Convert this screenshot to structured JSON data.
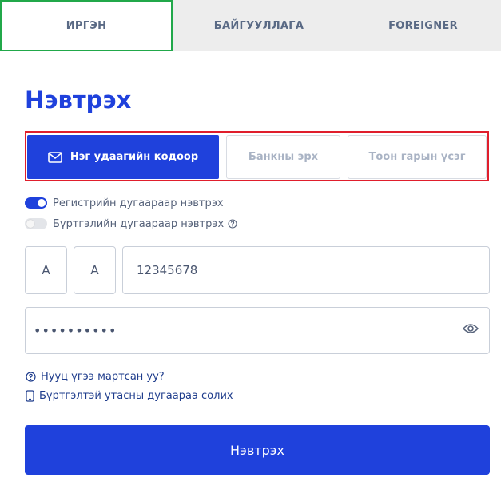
{
  "tabs": [
    {
      "label": "ИРГЭН"
    },
    {
      "label": "БАЙГУУЛЛАГА"
    },
    {
      "label": "FOREIGNER"
    }
  ],
  "title": "Нэвтрэх",
  "methods": [
    {
      "label": "Нэг удаагийн кодоор",
      "icon": "mail-icon",
      "active": true
    },
    {
      "label": "Банкны эрх",
      "active": false
    },
    {
      "label": "Тоон гарын үсэг",
      "active": false
    }
  ],
  "toggles": [
    {
      "label": "Регистрийн дугаараар нэвтрэх",
      "on": true
    },
    {
      "label": "Бүртгэлийн дугаараар нэвтрэх",
      "on": false,
      "icon": "help-icon"
    }
  ],
  "register": {
    "letter1": "А",
    "letter2": "А",
    "number": "12345678"
  },
  "password": {
    "masked": "••••••••••",
    "icon": "eye-icon"
  },
  "links": {
    "forgot": "Нууц үгээ мартсан уу?",
    "change_phone": "Бүртгэлтэй утасны дугаараа солих"
  },
  "submit_label": "Нэвтрэх",
  "colors": {
    "primary": "#1f41dc",
    "active_tab_border": "#21a84a",
    "highlight_border": "#e01e2c",
    "tab_bar": "#ededed"
  }
}
